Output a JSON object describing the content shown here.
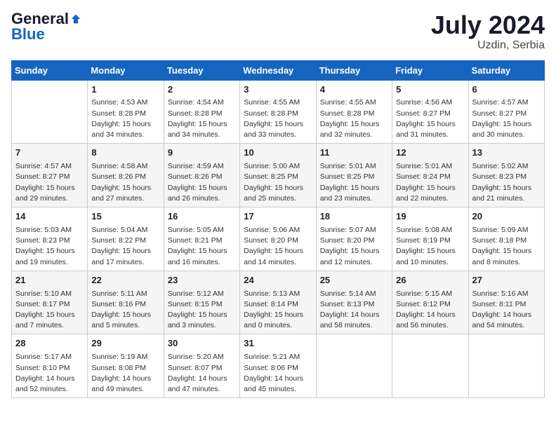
{
  "header": {
    "logo_general": "General",
    "logo_blue": "Blue",
    "title": "July 2024",
    "location": "Uzdin, Serbia"
  },
  "days_of_week": [
    "Sunday",
    "Monday",
    "Tuesday",
    "Wednesday",
    "Thursday",
    "Friday",
    "Saturday"
  ],
  "weeks": [
    [
      {
        "day": "",
        "info": ""
      },
      {
        "day": "1",
        "info": "Sunrise: 4:53 AM\nSunset: 8:28 PM\nDaylight: 15 hours\nand 34 minutes."
      },
      {
        "day": "2",
        "info": "Sunrise: 4:54 AM\nSunset: 8:28 PM\nDaylight: 15 hours\nand 34 minutes."
      },
      {
        "day": "3",
        "info": "Sunrise: 4:55 AM\nSunset: 8:28 PM\nDaylight: 15 hours\nand 33 minutes."
      },
      {
        "day": "4",
        "info": "Sunrise: 4:55 AM\nSunset: 8:28 PM\nDaylight: 15 hours\nand 32 minutes."
      },
      {
        "day": "5",
        "info": "Sunrise: 4:56 AM\nSunset: 8:27 PM\nDaylight: 15 hours\nand 31 minutes."
      },
      {
        "day": "6",
        "info": "Sunrise: 4:57 AM\nSunset: 8:27 PM\nDaylight: 15 hours\nand 30 minutes."
      }
    ],
    [
      {
        "day": "7",
        "info": "Sunrise: 4:57 AM\nSunset: 8:27 PM\nDaylight: 15 hours\nand 29 minutes."
      },
      {
        "day": "8",
        "info": "Sunrise: 4:58 AM\nSunset: 8:26 PM\nDaylight: 15 hours\nand 27 minutes."
      },
      {
        "day": "9",
        "info": "Sunrise: 4:59 AM\nSunset: 8:26 PM\nDaylight: 15 hours\nand 26 minutes."
      },
      {
        "day": "10",
        "info": "Sunrise: 5:00 AM\nSunset: 8:25 PM\nDaylight: 15 hours\nand 25 minutes."
      },
      {
        "day": "11",
        "info": "Sunrise: 5:01 AM\nSunset: 8:25 PM\nDaylight: 15 hours\nand 23 minutes."
      },
      {
        "day": "12",
        "info": "Sunrise: 5:01 AM\nSunset: 8:24 PM\nDaylight: 15 hours\nand 22 minutes."
      },
      {
        "day": "13",
        "info": "Sunrise: 5:02 AM\nSunset: 8:23 PM\nDaylight: 15 hours\nand 21 minutes."
      }
    ],
    [
      {
        "day": "14",
        "info": "Sunrise: 5:03 AM\nSunset: 8:23 PM\nDaylight: 15 hours\nand 19 minutes."
      },
      {
        "day": "15",
        "info": "Sunrise: 5:04 AM\nSunset: 8:22 PM\nDaylight: 15 hours\nand 17 minutes."
      },
      {
        "day": "16",
        "info": "Sunrise: 5:05 AM\nSunset: 8:21 PM\nDaylight: 15 hours\nand 16 minutes."
      },
      {
        "day": "17",
        "info": "Sunrise: 5:06 AM\nSunset: 8:20 PM\nDaylight: 15 hours\nand 14 minutes."
      },
      {
        "day": "18",
        "info": "Sunrise: 5:07 AM\nSunset: 8:20 PM\nDaylight: 15 hours\nand 12 minutes."
      },
      {
        "day": "19",
        "info": "Sunrise: 5:08 AM\nSunset: 8:19 PM\nDaylight: 15 hours\nand 10 minutes."
      },
      {
        "day": "20",
        "info": "Sunrise: 5:09 AM\nSunset: 8:18 PM\nDaylight: 15 hours\nand 8 minutes."
      }
    ],
    [
      {
        "day": "21",
        "info": "Sunrise: 5:10 AM\nSunset: 8:17 PM\nDaylight: 15 hours\nand 7 minutes."
      },
      {
        "day": "22",
        "info": "Sunrise: 5:11 AM\nSunset: 8:16 PM\nDaylight: 15 hours\nand 5 minutes."
      },
      {
        "day": "23",
        "info": "Sunrise: 5:12 AM\nSunset: 8:15 PM\nDaylight: 15 hours\nand 3 minutes."
      },
      {
        "day": "24",
        "info": "Sunrise: 5:13 AM\nSunset: 8:14 PM\nDaylight: 15 hours\nand 0 minutes."
      },
      {
        "day": "25",
        "info": "Sunrise: 5:14 AM\nSunset: 8:13 PM\nDaylight: 14 hours\nand 58 minutes."
      },
      {
        "day": "26",
        "info": "Sunrise: 5:15 AM\nSunset: 8:12 PM\nDaylight: 14 hours\nand 56 minutes."
      },
      {
        "day": "27",
        "info": "Sunrise: 5:16 AM\nSunset: 8:11 PM\nDaylight: 14 hours\nand 54 minutes."
      }
    ],
    [
      {
        "day": "28",
        "info": "Sunrise: 5:17 AM\nSunset: 8:10 PM\nDaylight: 14 hours\nand 52 minutes."
      },
      {
        "day": "29",
        "info": "Sunrise: 5:19 AM\nSunset: 8:08 PM\nDaylight: 14 hours\nand 49 minutes."
      },
      {
        "day": "30",
        "info": "Sunrise: 5:20 AM\nSunset: 8:07 PM\nDaylight: 14 hours\nand 47 minutes."
      },
      {
        "day": "31",
        "info": "Sunrise: 5:21 AM\nSunset: 8:06 PM\nDaylight: 14 hours\nand 45 minutes."
      },
      {
        "day": "",
        "info": ""
      },
      {
        "day": "",
        "info": ""
      },
      {
        "day": "",
        "info": ""
      }
    ]
  ]
}
